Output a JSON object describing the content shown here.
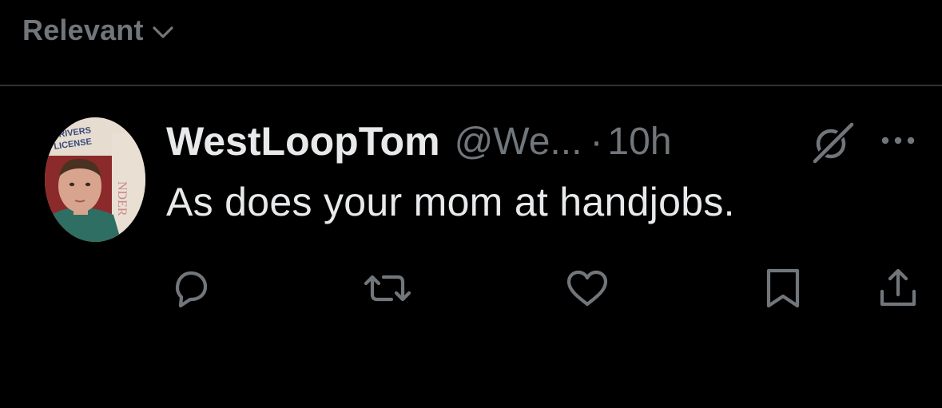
{
  "sort": {
    "label": "Relevant",
    "chevron_icon": "chevron-down-icon"
  },
  "tweet": {
    "avatar": {
      "icon": "avatar-drivers-license-photo",
      "text_line1": "DRIVERS",
      "text_line2": "LICENSE"
    },
    "display_name": "WestLoopTom",
    "handle": "@We...",
    "separator": "·",
    "time": "10h",
    "text": "As does your mom at handjobs.",
    "header_icons": [
      "grok-icon",
      "more-icon"
    ],
    "actions": [
      {
        "name": "reply",
        "icon": "reply-icon"
      },
      {
        "name": "repost",
        "icon": "repost-icon"
      },
      {
        "name": "like",
        "icon": "heart-icon"
      },
      {
        "name": "bookmark",
        "icon": "bookmark-icon"
      },
      {
        "name": "share",
        "icon": "share-icon"
      }
    ]
  },
  "colors": {
    "background": "#000000",
    "primary_text": "#e7e9ea",
    "secondary_text": "#71767b",
    "divider": "#2f3336"
  }
}
